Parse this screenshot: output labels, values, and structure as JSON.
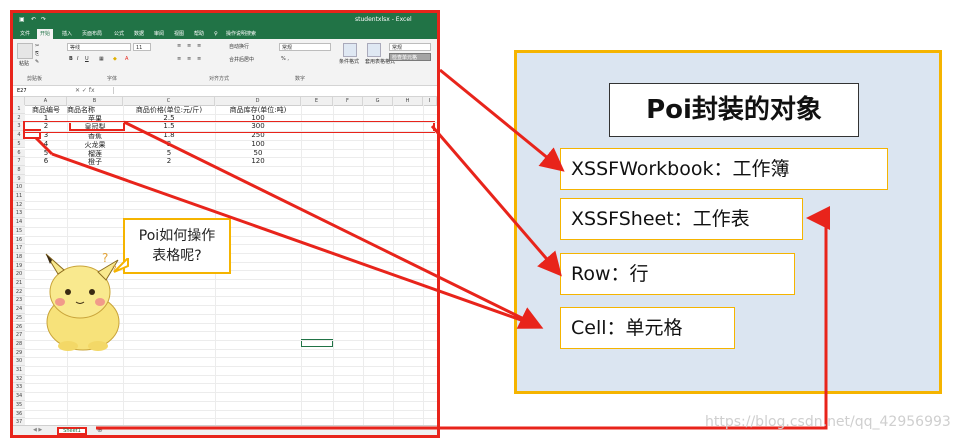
{
  "excel": {
    "title": "studentxlsx - Excel",
    "ribbon_tabs": [
      "文件",
      "开始",
      "插入",
      "页面布局",
      "公式",
      "数据",
      "审阅",
      "视图",
      "帮助",
      "操作说明搜索"
    ],
    "active_tab": "开始",
    "ribbon": {
      "font_name": "等线",
      "font_size": "11",
      "number_format": "常规",
      "cell_style": "常规",
      "group_clipboard": "剪贴板",
      "group_font": "字体",
      "group_align": "对齐方式",
      "group_number": "数字",
      "paste": "粘贴",
      "wrap": "自动换行",
      "merge": "合并后居中",
      "cond_format": "条件格式",
      "table_format": "套用表格格式",
      "good_cell": "检查单元格"
    },
    "name_box": "E27",
    "columns": [
      "A",
      "B",
      "C",
      "D",
      "E",
      "F",
      "G",
      "H",
      "I"
    ],
    "headers": [
      "商品编号",
      "商品名称",
      "商品价格(单位:元/斤)",
      "商品库存(单位:吨)"
    ],
    "rows": [
      [
        "1",
        "苹果",
        "2.5",
        "100"
      ],
      [
        "2",
        "皇冠梨",
        "1.5",
        "300"
      ],
      [
        "3",
        "香蕉",
        "1.8",
        "250"
      ],
      [
        "4",
        "火龙果",
        "3",
        "100"
      ],
      [
        "5",
        "榴莲",
        "5",
        "50"
      ],
      [
        "6",
        "橙子",
        "2",
        "120"
      ]
    ],
    "row_numbers": [
      "1",
      "2",
      "3",
      "4",
      "5",
      "6",
      "7",
      "8",
      "9",
      "10",
      "11",
      "12",
      "13",
      "14",
      "15",
      "16",
      "17",
      "18",
      "19",
      "20",
      "21",
      "22",
      "23",
      "24",
      "25",
      "26",
      "27",
      "28",
      "29",
      "30",
      "31",
      "32",
      "33",
      "34",
      "35",
      "36",
      "37"
    ],
    "sheet_tab": "Sheet1"
  },
  "bubble": {
    "line1": "Poi如何操作",
    "line2": "表格呢?"
  },
  "panel": {
    "title": "Poi封装的对象",
    "items": [
      "XSSFWorkbook：工作簿",
      "XSSFSheet：工作表",
      "Row：行",
      "Cell：单元格"
    ]
  },
  "watermark": "https://blog.csdn.net/qq_42956993",
  "colors": {
    "excel_green": "#217346",
    "highlight_red": "#e8241b",
    "panel_bg": "#dbe5f1",
    "panel_border": "#f5b400"
  }
}
